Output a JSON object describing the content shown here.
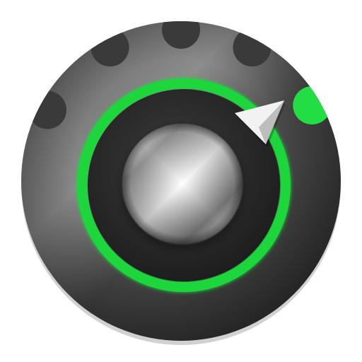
{
  "icon": {
    "name": "volume-knob-app-icon",
    "symbol": "volume-knob-icon",
    "level_indicator": {
      "total_positions": 5,
      "active_positions": 1,
      "active_color": "#22DD44",
      "inactive_color": "#3A3A3A"
    },
    "colors": {
      "bezel_light": "#8C8C8C",
      "bezel_dark": "#2E2E2E",
      "ring_accent": "#1FD63A",
      "knob_face_light": "#EDEDED",
      "knob_face_dark": "#3F3F3F",
      "pointer": "#F2F2F2"
    }
  }
}
